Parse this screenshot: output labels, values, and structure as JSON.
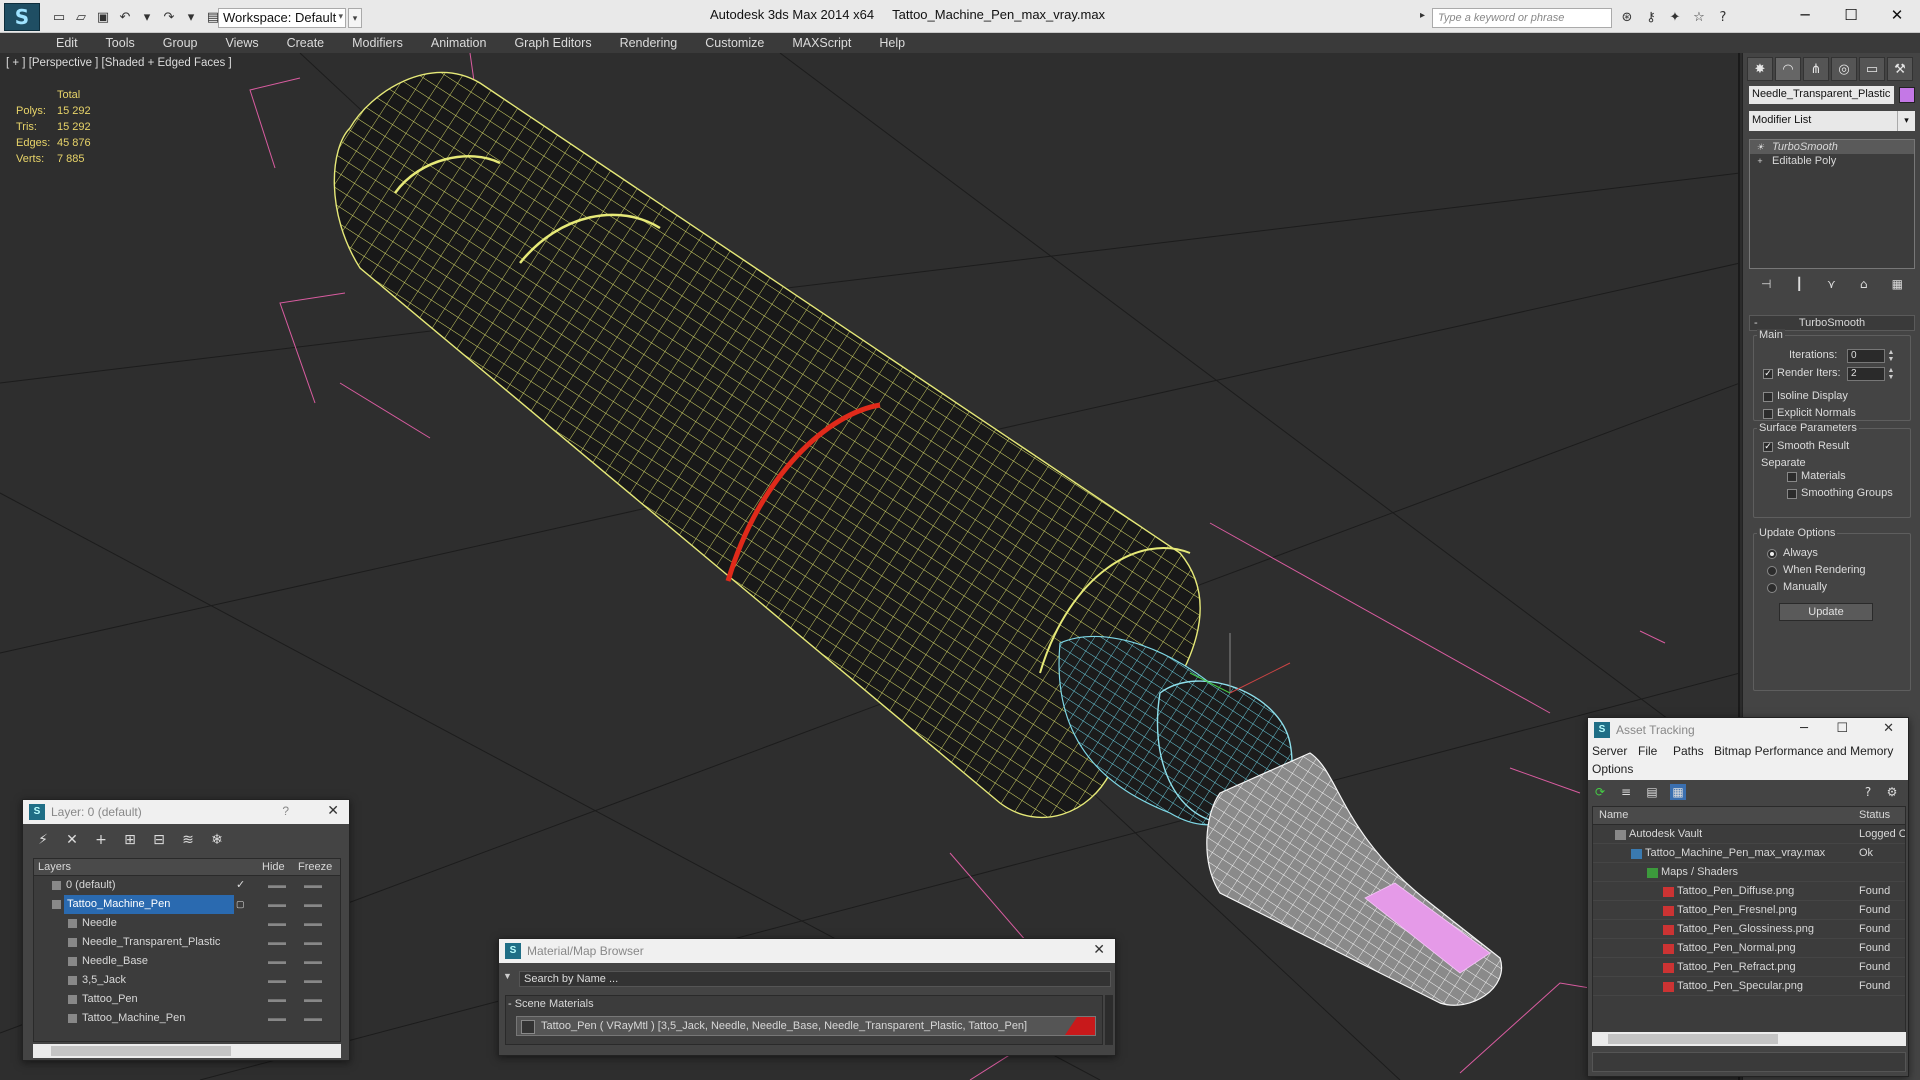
{
  "titlebar": {
    "app": "Autodesk 3ds Max  2014 x64",
    "file": "Tattoo_Machine_Pen_max_vray.max",
    "workspace": "Workspace: Default",
    "search_placeholder": "Type a keyword or phrase"
  },
  "menu": [
    "Edit",
    "Tools",
    "Group",
    "Views",
    "Create",
    "Modifiers",
    "Animation",
    "Graph Editors",
    "Rendering",
    "Customize",
    "MAXScript",
    "Help"
  ],
  "viewport": {
    "label": "[ + ] [Perspective ] [Shaded + Edged Faces ]",
    "stats": {
      "header": "Total",
      "polys_label": "Polys:",
      "polys": "15 292",
      "tris_label": "Tris:",
      "tris": "15 292",
      "edges_label": "Edges:",
      "edges": "45 876",
      "verts_label": "Verts:",
      "verts": "7 885"
    }
  },
  "command_panel": {
    "object_name": "Needle_Transparent_Plastic",
    "object_color": "#c478e6",
    "modifier_list": "Modifier List",
    "stack": [
      "TurboSmooth",
      "Editable Poly"
    ],
    "rollout_title": "TurboSmooth",
    "main_label": "Main",
    "iterations_label": "Iterations:",
    "iterations": "0",
    "render_iters_label": "Render Iters:",
    "render_iters": "2",
    "isoline": "Isoline Display",
    "explicit_normals": "Explicit Normals",
    "surface_params": "Surface Parameters",
    "smooth_result": "Smooth Result",
    "separate": "Separate",
    "materials": "Materials",
    "smoothing_groups": "Smoothing Groups",
    "update_options": "Update Options",
    "always": "Always",
    "when_rendering": "When Rendering",
    "manually": "Manually",
    "update_btn": "Update"
  },
  "layer_window": {
    "title": "Layer: 0 (default)",
    "help": "?",
    "col_layers": "Layers",
    "col_hide": "Hide",
    "col_freeze": "Freeze",
    "rows": [
      {
        "name": "0 (default)",
        "indent": 1
      },
      {
        "name": "Tattoo_Machine_Pen",
        "indent": 1,
        "selected": true
      },
      {
        "name": "Needle",
        "indent": 2
      },
      {
        "name": "Needle_Transparent_Plastic",
        "indent": 2
      },
      {
        "name": "Needle_Base",
        "indent": 2
      },
      {
        "name": "3,5_Jack",
        "indent": 2
      },
      {
        "name": "Tattoo_Pen",
        "indent": 2
      },
      {
        "name": "Tattoo_Machine_Pen",
        "indent": 2
      }
    ]
  },
  "material_browser": {
    "title": "Material/Map Browser",
    "search_placeholder": "Search by Name ...",
    "group": "- Scene Materials",
    "item": "Tattoo_Pen  ( VRayMtl )  [3,5_Jack, Needle, Needle_Base, Needle_Transparent_Plastic, Tattoo_Pen]"
  },
  "asset_tracking": {
    "title": "Asset Tracking",
    "menu": [
      "Server",
      "File",
      "Paths",
      "Bitmap Performance and Memory",
      "Options"
    ],
    "col_name": "Name",
    "col_status": "Status",
    "rows": [
      {
        "name": "Autodesk Vault",
        "status": "Logged O",
        "indent": 1,
        "icon": "vault"
      },
      {
        "name": "Tattoo_Machine_Pen_max_vray.max",
        "status": "Ok",
        "indent": 2,
        "icon": "max"
      },
      {
        "name": "Maps / Shaders",
        "status": "",
        "indent": 3,
        "icon": "maps"
      },
      {
        "name": "Tattoo_Pen_Diffuse.png",
        "status": "Found",
        "indent": 4,
        "icon": "png"
      },
      {
        "name": "Tattoo_Pen_Fresnel.png",
        "status": "Found",
        "indent": 4,
        "icon": "png"
      },
      {
        "name": "Tattoo_Pen_Glossiness.png",
        "status": "Found",
        "indent": 4,
        "icon": "png"
      },
      {
        "name": "Tattoo_Pen_Normal.png",
        "status": "Found",
        "indent": 4,
        "icon": "png"
      },
      {
        "name": "Tattoo_Pen_Refract.png",
        "status": "Found",
        "indent": 4,
        "icon": "png"
      },
      {
        "name": "Tattoo_Pen_Specular.png",
        "status": "Found",
        "indent": 4,
        "icon": "png"
      }
    ]
  }
}
